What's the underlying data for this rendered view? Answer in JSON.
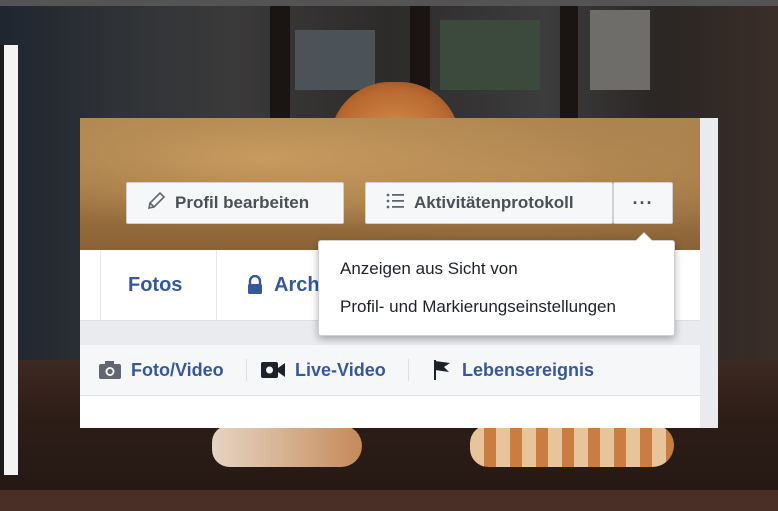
{
  "profile": {
    "edit_profile_label": "Profil bearbeiten",
    "activity_log_label": "Aktivitätenprotokoll",
    "more_label": "···"
  },
  "tabs": [
    {
      "label": "Fotos"
    },
    {
      "label": "Arch"
    }
  ],
  "composer": {
    "photo_video": "Foto/Video",
    "live_video": "Live-Video",
    "life_event": "Lebensereignis"
  },
  "dropdown": {
    "items": [
      {
        "label": "Anzeigen aus Sicht von"
      },
      {
        "label": "Profil- und Markierungseinstellungen"
      }
    ]
  },
  "colors": {
    "link_blue": "#365899",
    "button_text": "#4b4f56",
    "menu_text": "#1d2129"
  }
}
